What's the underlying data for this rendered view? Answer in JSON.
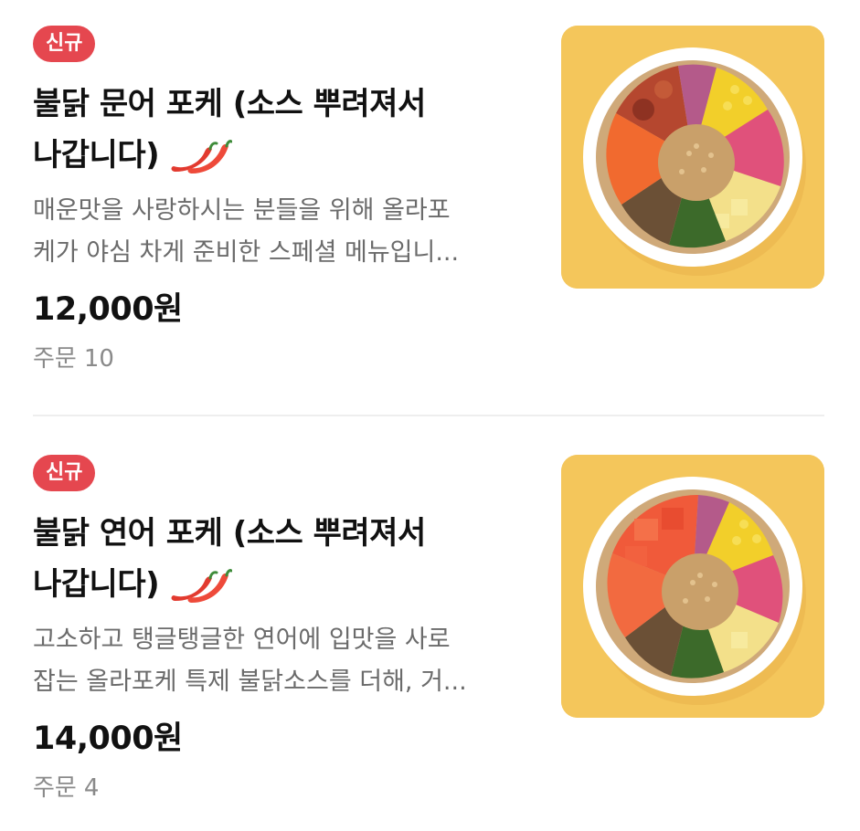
{
  "items": [
    {
      "badge": "신규",
      "title_line1": "불닭 문어 포케 (소스 뿌려져서",
      "title_line2": "나갑니다)",
      "spice_icon": "chili-pepper-icon",
      "desc_line1": "매운맛을 사랑하시는 분들을 위해 올라포",
      "desc_line2": "케가 야심 차게 준비한 스페셜 메뉴입니...",
      "price": "12,000원",
      "orders_label": "주문",
      "orders_count": "10"
    },
    {
      "badge": "신규",
      "title_line1": "불닭 연어 포케 (소스 뿌려져서",
      "title_line2": "나갑니다)",
      "spice_icon": "chili-pepper-icon",
      "desc_line1": "고소하고 탱글탱글한 연어에 입맛을 사로",
      "desc_line2": "잡는 올라포케 특제 불닭소스를 더해, 거...",
      "price": "14,000원",
      "orders_label": "주문",
      "orders_count": "4"
    }
  ],
  "colors": {
    "badge": "#e5474f",
    "thumb_background": "#f4c65b",
    "divider": "#eeeeee"
  }
}
